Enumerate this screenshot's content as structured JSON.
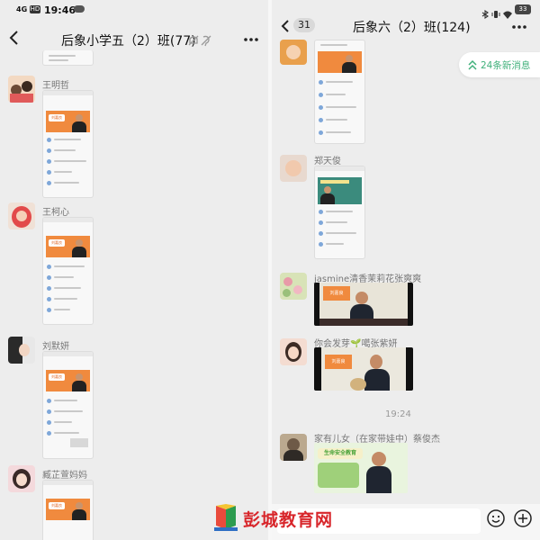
{
  "status_bar": {
    "time": "19:46",
    "network": "4G",
    "hd": "HD",
    "battery": "33"
  },
  "left_chat": {
    "title": "后象小学五（2）班(77)",
    "messages": [
      {
        "name": "王明哲",
        "thumb_badge": "刘嘉良"
      },
      {
        "name": "王柯心",
        "thumb_badge": "刘嘉良"
      },
      {
        "name": "刘默妍",
        "thumb_badge": "刘嘉良"
      },
      {
        "name": "臧芷萱妈妈",
        "thumb_badge": "刘嘉良"
      }
    ]
  },
  "right_chat": {
    "back_count": "31",
    "title": "后象六（2）班(124)",
    "new_messages": "24条新消息",
    "time_divider": "19:24",
    "messages": [
      {
        "name": "郑天俊"
      },
      {
        "name": "jasmine清香茉莉花张爽爽",
        "thumb_badge": "刘嘉良"
      },
      {
        "name": "你会发芽🌱噶张紫妍",
        "thumb_badge": "刘嘉良"
      },
      {
        "name": "家有儿女（在家带娃中）蔡俊杰",
        "thumb_badge": "生命安全教育"
      }
    ]
  },
  "watermark": "彭城教育网"
}
